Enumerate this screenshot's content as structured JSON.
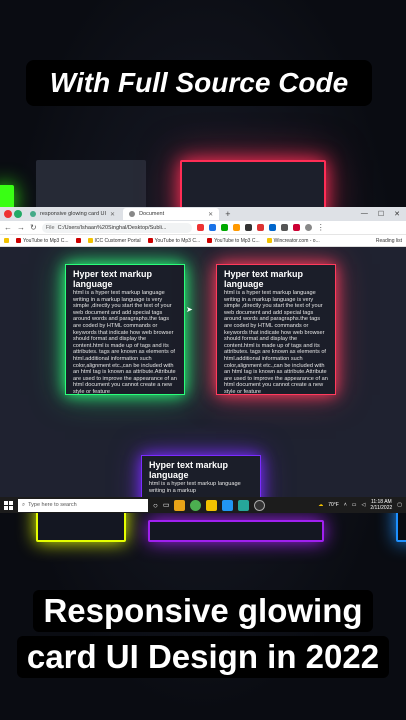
{
  "headline_top": "With Full Source Code",
  "headline_bottom": [
    "Responsive glowing",
    "card UI Design in 2022"
  ],
  "browser": {
    "tabs": [
      {
        "label": "responsive glowing card UI"
      },
      {
        "label": "Document"
      }
    ],
    "new_tab": "+",
    "window_controls": [
      "—",
      "☐",
      "✕"
    ],
    "address": "C:/Users/Ishaan%20Singhal/Desktop/Subli...",
    "address_prefix": "File",
    "bookmarks": [
      {
        "label": "YouTube to Mp3 C..."
      },
      {
        "label": "ICC Customer Portal"
      },
      {
        "label": "YouTube to Mp3 C..."
      },
      {
        "label": "YouTube to Mp3 C..."
      },
      {
        "label": "Wincreator.com - o..."
      }
    ],
    "reading_list": "Reading list"
  },
  "cards": [
    {
      "title": "Hyper text markup language",
      "body": "html is a hyper text markup language writing in a markup language is very simple ,directly you start the text of your web document and add special tags around words and paragraphs.the tags are coded by HTML commands or keywords that indicate how web browser should format and display the content.html is made up of tags and its attributes. tags are known as elements of html.additional information such color,alignment etc.,can be included with an html tag is known as attribute.Attribute are used to improve the appearance of an html document you cannot create a new style or feature"
    },
    {
      "title": "Hyper text markup language",
      "body": "html is a hyper text markup language writing in a markup language is very simple ,directly you start the text of your web document and add special tags around words and paragraphs.the tags are coded by HTML commands or keywords that indicate how web browser should format and display the content.html is made up of tags and its attributes. tags are known as elements of html.additional information such color,alignment etc.,can be included with an html tag is known as attribute.Attribute are used to improve the appearance of an html document you cannot create a new style or feature"
    },
    {
      "title": "Hyper text markup language",
      "body": "html is a hyper text markup language writing in a markup"
    }
  ],
  "taskbar": {
    "search_placeholder": "Type here to search",
    "weather": "70°F",
    "time": "11:18 AM",
    "date": "2/11/2022"
  }
}
